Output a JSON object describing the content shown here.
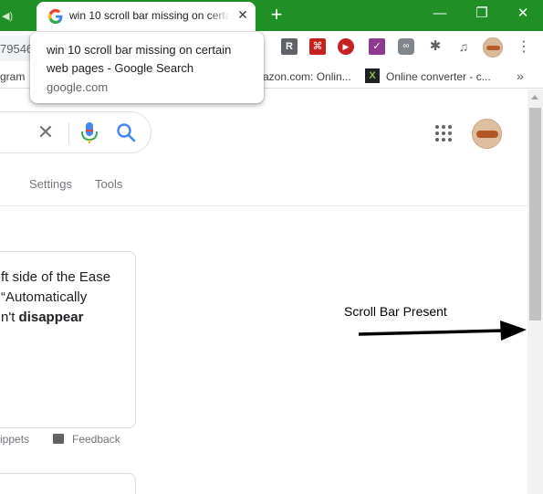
{
  "window": {
    "prev_tab_fragment": "◀)",
    "tab_title": "win 10 scroll bar missing on certain web pages - Google Search",
    "tab_close": "✕",
    "new_tab": "+",
    "minimize": "—",
    "maximize": "❐",
    "close": "✕"
  },
  "toolbar": {
    "omnibox_fragment": "79546",
    "extensions": [
      {
        "name": "r-extension-icon",
        "glyph": "R"
      },
      {
        "name": "pdf-icon",
        "glyph": "⌘"
      },
      {
        "name": "play-icon",
        "glyph": "▶"
      },
      {
        "name": "checkmark-extension-icon",
        "glyph": "✓"
      },
      {
        "name": "loop-extension-icon",
        "glyph": "∞"
      },
      {
        "name": "puzzle-icon",
        "glyph": "✱"
      },
      {
        "name": "media-control-icon",
        "glyph": "♫"
      }
    ],
    "menu": "⋮"
  },
  "bookmarks": {
    "item1": "gram",
    "item2": "azon.com: Onlin...",
    "item3": "Online converter - c...",
    "item3_icon": "X",
    "more": "»"
  },
  "tooltip": {
    "title": "win 10 scroll bar missing on certain web pages - Google Search",
    "url": "google.com"
  },
  "search": {
    "clear": "✕",
    "tabs": [
      "Settings",
      "Tools"
    ]
  },
  "result": {
    "line1": "ft side of the Ease",
    "line2": "“Automatically",
    "line3_prefix": "n't ",
    "line3_bold": "disappear",
    "footer_snippets": "ippets",
    "footer_feedback": "Feedback"
  },
  "annotation": {
    "label": "Scroll Bar Present"
  },
  "colors": {
    "titlebar": "#1f8f26",
    "arrow": "#000000",
    "scroll_thumb": "#c1c1c1"
  }
}
